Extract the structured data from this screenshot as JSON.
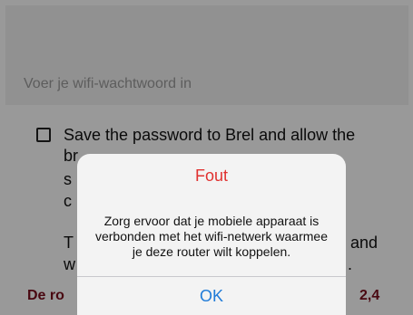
{
  "wifi_form": {
    "password_placeholder": "Voer je  wifi-wachtwoord in",
    "save_line1": "Save the password to Brel and allow the",
    "frag_br": "br",
    "frag_s": "s",
    "frag_c": "c",
    "frag_t": "T",
    "frag_and": "and",
    "frag_w": "w",
    "frag_dot": ".",
    "bottom_left": "De ro",
    "bottom_right": "2,4"
  },
  "alert": {
    "title": "Fout",
    "message": "Zorg ervoor dat je mobiele apparaat is verbonden met het wifi-netwerk waarmee je deze router wilt koppelen.",
    "ok_label": "OK"
  }
}
